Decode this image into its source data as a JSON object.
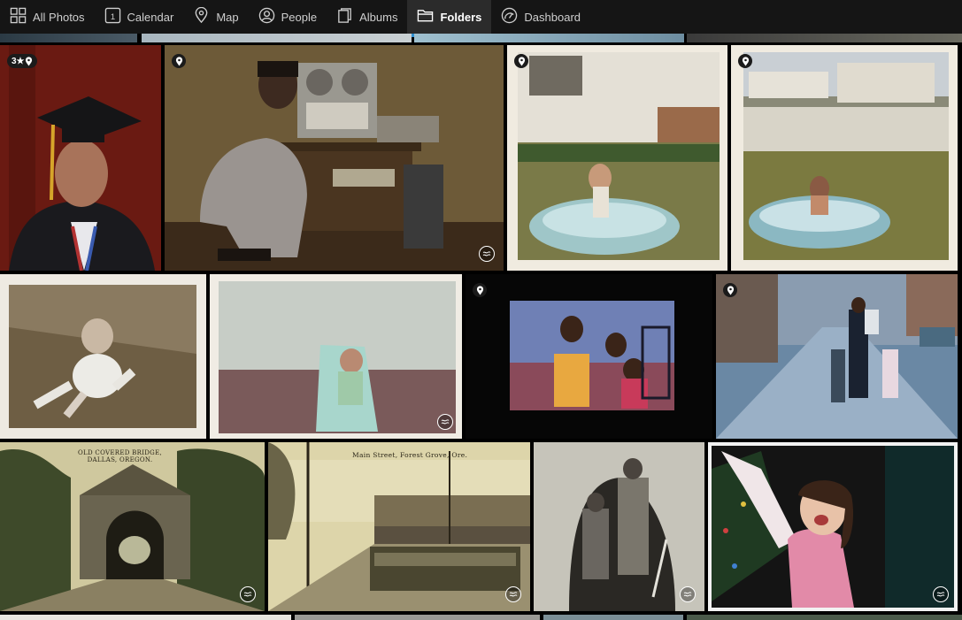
{
  "nav": {
    "tabs": [
      {
        "label": "All Photos",
        "icon": "grid-icon"
      },
      {
        "label": "Calendar",
        "icon": "calendar-icon",
        "day": "1"
      },
      {
        "label": "Map",
        "icon": "map-pin-icon"
      },
      {
        "label": "People",
        "icon": "person-icon"
      },
      {
        "label": "Albums",
        "icon": "albums-icon"
      },
      {
        "label": "Folders",
        "icon": "folder-icon",
        "active": true
      },
      {
        "label": "Dashboard",
        "icon": "dashboard-icon"
      }
    ],
    "accent": "#2f8fd0"
  },
  "photos": [
    {
      "name": "graduate-portrait",
      "badge": "3★",
      "location": true
    },
    {
      "name": "man-with-stereo",
      "location": true,
      "live": true
    },
    {
      "name": "toddler-in-pool",
      "location": true
    },
    {
      "name": "child-in-pool-yard",
      "location": true
    },
    {
      "name": "baby-on-grass"
    },
    {
      "name": "baby-on-blanket",
      "live": true
    },
    {
      "name": "children-on-bed",
      "location": true
    },
    {
      "name": "family-on-sidewalk",
      "location": true
    },
    {
      "name": "covered-bridge-postcard",
      "caption": "OLD COVERED BRIDGE,\nDALLAS, OREGON.",
      "live": true
    },
    {
      "name": "main-street-postcard",
      "caption": "Main Street, Forest Grove, Ore.",
      "live": true
    },
    {
      "name": "miners-in-tunnel",
      "live": true
    },
    {
      "name": "girl-with-tree",
      "live": true
    }
  ]
}
